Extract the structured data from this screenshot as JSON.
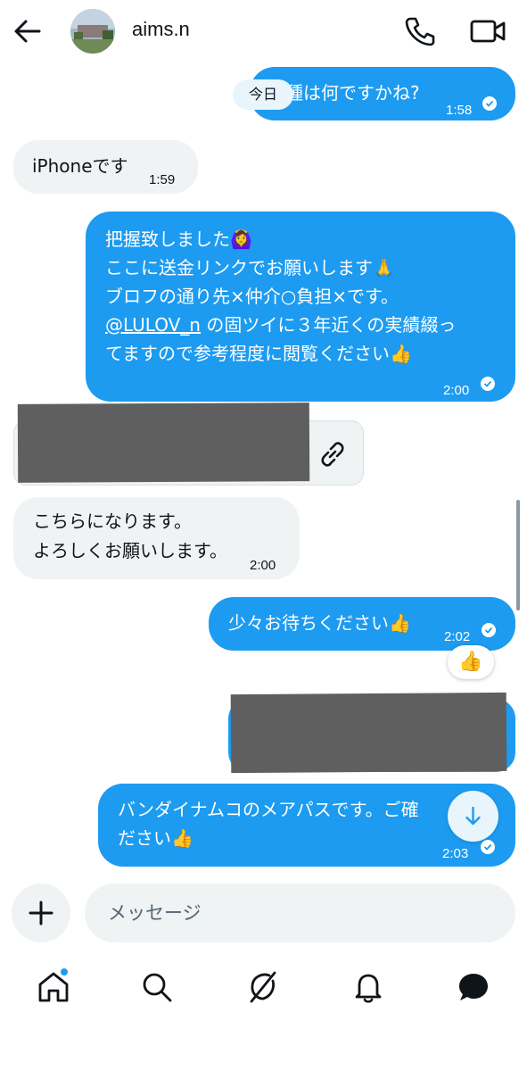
{
  "header": {
    "title": "aims.n"
  },
  "date_separator": "今日",
  "messages": [
    {
      "text": "種は何ですかね?",
      "time": "1:58"
    },
    {
      "text": "iPhoneです",
      "time": "1:59"
    },
    {
      "lines": [
        "把握致しました🙆‍♀️",
        "ここに送金リンクでお願いします🙏",
        "ブロフの通り先×仲介○負担×です。",
        "@LULOV_n の固ツイに３年近くの実績綴っ",
        "てますので参考程度に閲覧ください👍"
      ],
      "mention": "@LULOV_n",
      "time": "2:00"
    },
    {
      "lines": [
        "こちらになります。",
        "よろしくお願いします。"
      ],
      "time": "2:00"
    },
    {
      "text": "少々お待ちください👍",
      "time": "2:02",
      "reaction": "👍"
    },
    {
      "lines": [
        "バンダイナムコのメアパスです。ご確",
        "ださい👍"
      ],
      "time": "2:03"
    }
  ],
  "composer": {
    "placeholder": "メッセージ"
  },
  "colors": {
    "accent": "#1d9bf0",
    "incoming_bubble": "#eff3f4",
    "redaction": "#5f5f5f"
  },
  "icons": [
    "back-arrow-icon",
    "phone-icon",
    "video-icon",
    "link-icon",
    "arrow-down-icon",
    "plus-icon",
    "home-icon",
    "search-icon",
    "grok-icon",
    "bell-icon",
    "messages-icon"
  ]
}
